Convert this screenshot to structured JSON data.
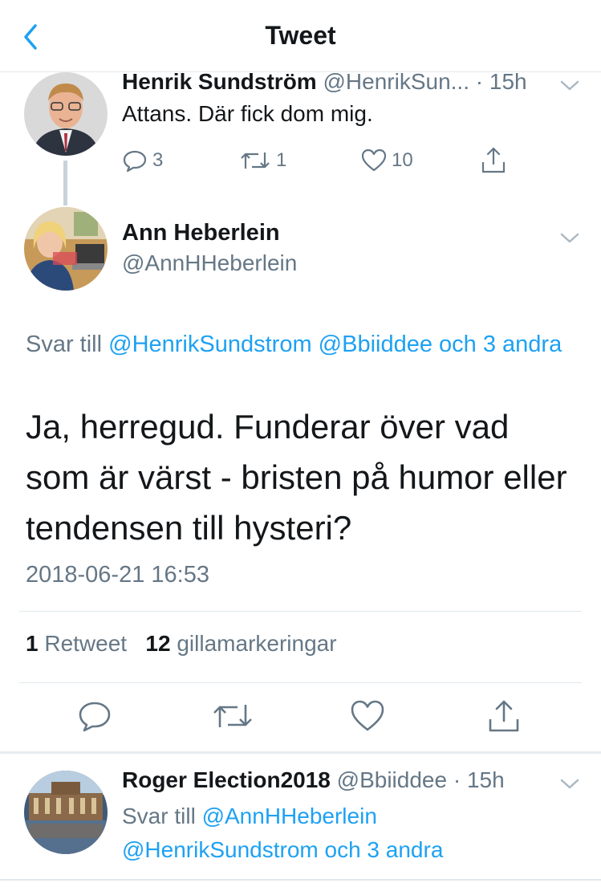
{
  "header": {
    "title": "Tweet"
  },
  "parent_tweet": {
    "name": "Henrik Sundström",
    "handle": "@HenrikSun...",
    "time": "· 15h",
    "text": "Attans. Där fick dom mig.",
    "replies": "3",
    "retweets": "1",
    "likes": "10"
  },
  "main_tweet": {
    "name": "Ann Heberlein",
    "handle": "@AnnHHeberlein",
    "reply_prefix": "Svar till",
    "reply_targets": "@HenrikSundstrom @Bbiiddee och 3 andra",
    "text": "Ja, herregud. Funderar över vad som är värst - bristen på humor eller tendensen till hysteri?",
    "timestamp": "2018-06-21 16:53",
    "retweet_count": "1",
    "retweet_label": "Retweet",
    "like_count": "12",
    "like_label": "gillamarkeringar"
  },
  "reply_tweet": {
    "name": "Roger Election2018",
    "handle": "@Bbiiddee",
    "time": "· 15h",
    "reply_prefix": "Svar till",
    "reply_targets": "@AnnHHeberlein @HenrikSundstrom och 3 andra"
  },
  "colors": {
    "accent": "#1da1f2",
    "muted": "#657786",
    "text": "#14171a",
    "separator": "#e1e8ed"
  }
}
